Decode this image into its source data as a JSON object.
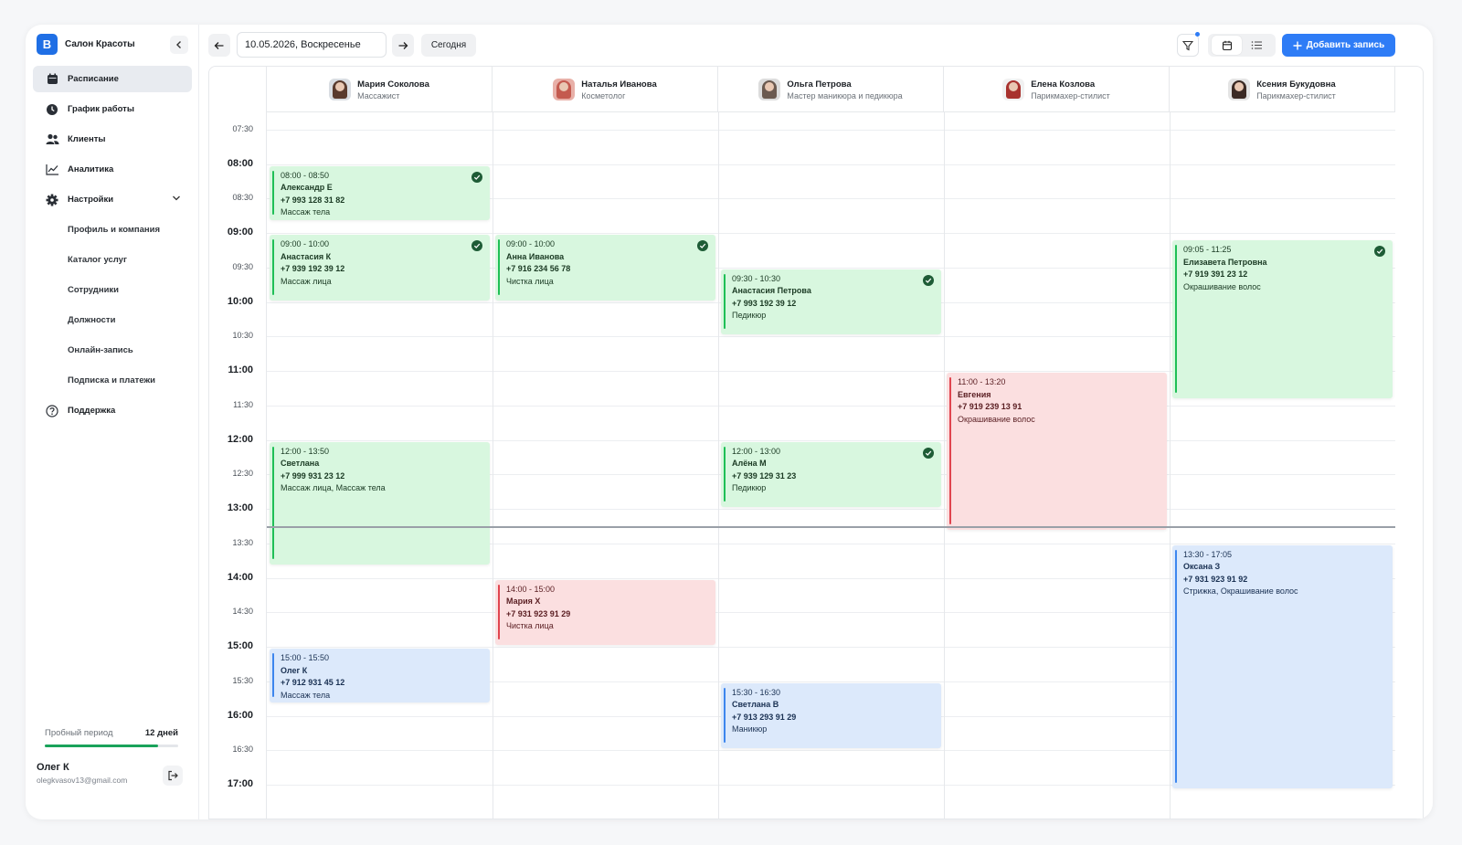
{
  "sidebar": {
    "logo_letter": "B",
    "brand_name": "Салон Красоты",
    "nav": [
      {
        "label": "Расписание",
        "icon": "calendar-icon"
      },
      {
        "label": "График работы",
        "icon": "clock-icon"
      },
      {
        "label": "Клиенты",
        "icon": "users-icon"
      },
      {
        "label": "Аналитика",
        "icon": "chart-icon"
      },
      {
        "label": "Настройки",
        "icon": "gear-icon"
      }
    ],
    "settings_sub": [
      "Профиль и компания",
      "Каталог услуг",
      "Сотрудники",
      "Должности",
      "Онлайн-запись",
      "Подписка и платежи"
    ],
    "support": "Поддержка",
    "trial_label": "Пробный период",
    "trial_days": "12 дней",
    "trial_progress": 0.85,
    "user_name": "Олег К",
    "user_email": "olegkvasov13@gmail.com"
  },
  "topbar": {
    "date": "10.05.2026, Воскресенье",
    "today": "Сегодня",
    "add": "Добавить запись"
  },
  "staff": [
    {
      "name": "Мария Соколова",
      "role": "Массажист"
    },
    {
      "name": "Наталья Иванова",
      "role": "Косметолог"
    },
    {
      "name": "Ольга Петрова",
      "role": "Мастер маникюра и педикюра"
    },
    {
      "name": "Елена Козлова",
      "role": "Парикмахер-стилист"
    },
    {
      "name": "Ксения Букудовна",
      "role": "Парикмахер-стилист"
    }
  ],
  "times": [
    "07:30",
    "08:00",
    "08:30",
    "09:00",
    "09:30",
    "10:00",
    "10:30",
    "11:00",
    "11:30",
    "12:00",
    "12:30",
    "13:00",
    "13:30",
    "14:00",
    "14:30",
    "15:00",
    "15:30",
    "16:00",
    "16:30",
    "17:00"
  ],
  "appointments": [
    {
      "col": 0,
      "start": "08:00",
      "end": "08:50",
      "time": "08:00 - 08:50",
      "name": "Александр Е",
      "phone": "+7 993 128 31 82",
      "service": "Массаж тела",
      "color": "green",
      "checked": true
    },
    {
      "col": 0,
      "start": "09:00",
      "end": "10:00",
      "time": "09:00 - 10:00",
      "name": "Анастасия К",
      "phone": "+7 939 192 39 12",
      "service": "Массаж лица",
      "color": "green",
      "checked": true
    },
    {
      "col": 0,
      "start": "12:00",
      "end": "13:50",
      "time": "12:00 - 13:50",
      "name": "Светлана",
      "phone": "+7 999 931 23 12",
      "service": "Массаж лица, Массаж тела",
      "color": "green",
      "checked": false
    },
    {
      "col": 0,
      "start": "15:00",
      "end": "15:50",
      "time": "15:00 - 15:50",
      "name": "Олег К",
      "phone": "+7 912 931 45 12",
      "service": "Массаж тела",
      "color": "blue",
      "checked": false
    },
    {
      "col": 1,
      "start": "09:00",
      "end": "10:00",
      "time": "09:00 - 10:00",
      "name": "Анна Иванова",
      "phone": "+7 916 234 56 78",
      "service": "Чистка лица",
      "color": "green",
      "checked": true
    },
    {
      "col": 1,
      "start": "14:00",
      "end": "15:00",
      "time": "14:00 - 15:00",
      "name": "Мария Х",
      "phone": "+7 931 923 91 29",
      "service": "Чистка лица",
      "color": "red",
      "checked": false
    },
    {
      "col": 2,
      "start": "09:30",
      "end": "10:30",
      "time": "09:30 - 10:30",
      "name": "Анастасия Петрова",
      "phone": "+7 993 192 39 12",
      "service": "Педикюр",
      "color": "green",
      "checked": true
    },
    {
      "col": 2,
      "start": "12:00",
      "end": "13:00",
      "time": "12:00 - 13:00",
      "name": "Алёна М",
      "phone": "+7 939 129 31 23",
      "service": "Педикюр",
      "color": "green",
      "checked": true
    },
    {
      "col": 2,
      "start": "15:30",
      "end": "16:30",
      "time": "15:30 - 16:30",
      "name": "Светлана В",
      "phone": "+7 913 293 91 29",
      "service": "Маникюр",
      "color": "blue",
      "checked": false
    },
    {
      "col": 3,
      "start": "11:00",
      "end": "13:20",
      "time": "11:00 - 13:20",
      "name": "Евгения",
      "phone": "+7 919 239 13 91",
      "service": "Окрашивание волос",
      "color": "red",
      "checked": false
    },
    {
      "col": 4,
      "start": "09:05",
      "end": "11:25",
      "time": "09:05 - 11:25",
      "name": "Елизавета Петровна",
      "phone": "+7 919 391 23 12",
      "service": "Окрашивание волос",
      "color": "green",
      "checked": true
    },
    {
      "col": 4,
      "start": "13:30",
      "end": "17:05",
      "time": "13:30 - 17:05",
      "name": "Оксана З",
      "phone": "+7 931 923 91 92",
      "service": "Стрижка, Окрашивание волос",
      "color": "blue",
      "checked": false
    }
  ],
  "now_time": "13:15"
}
